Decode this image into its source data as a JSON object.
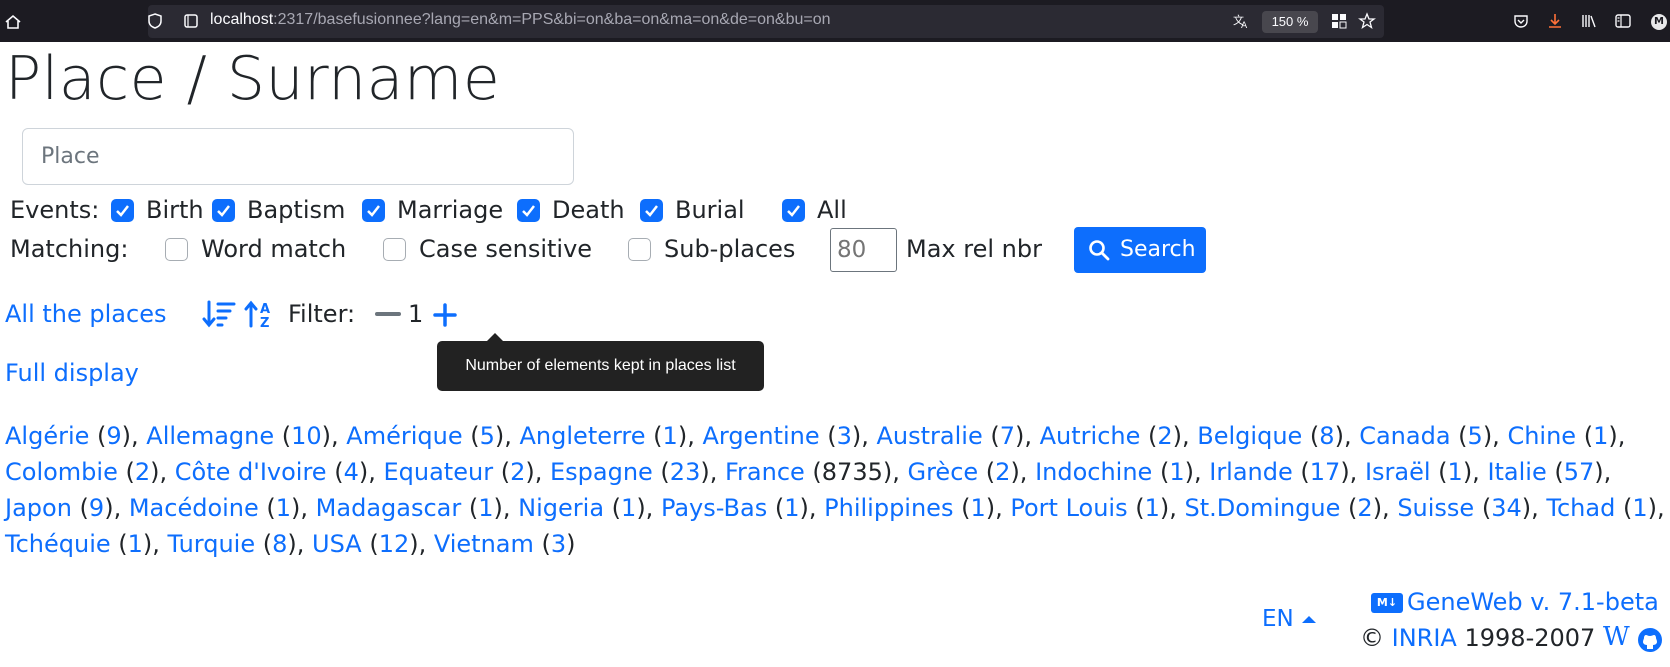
{
  "browser": {
    "url_host": "localhost",
    "url_rest": ":2317/basefusionnee?lang=en&m=PPS&bi=on&ba=on&ma=on&de=on&bu=on",
    "zoom": "150 %",
    "avatar_letter": "M"
  },
  "page": {
    "title": "Place / Surname",
    "place_placeholder": "Place",
    "events_label": "Events:",
    "events": [
      {
        "label": "Birth",
        "checked": true
      },
      {
        "label": "Baptism",
        "checked": true
      },
      {
        "label": "Marriage",
        "checked": true
      },
      {
        "label": "Death",
        "checked": true
      },
      {
        "label": "Burial",
        "checked": true
      },
      {
        "label": "All",
        "checked": true
      }
    ],
    "matching_label": "Matching:",
    "matching": [
      {
        "label": "Word match",
        "checked": false
      },
      {
        "label": "Case sensitive",
        "checked": false
      },
      {
        "label": "Sub-places",
        "checked": false
      }
    ],
    "max_rel_placeholder": "80",
    "max_rel_label": "Max rel nbr",
    "search_label": "Search",
    "all_places_label": "All the places",
    "filter_label": "Filter:",
    "filter_value": "1",
    "tooltip": "Number of elements kept in places list",
    "full_display_label": "Full display",
    "places": [
      {
        "name": "Algérie",
        "count": "9"
      },
      {
        "name": "Allemagne",
        "count": "10"
      },
      {
        "name": "Amérique",
        "count": "5"
      },
      {
        "name": "Angleterre",
        "count": "1"
      },
      {
        "name": "Argentine",
        "count": "3"
      },
      {
        "name": "Australie",
        "count": "7"
      },
      {
        "name": "Autriche",
        "count": "2"
      },
      {
        "name": "Belgique",
        "count": "8"
      },
      {
        "name": "Canada",
        "count": "5"
      },
      {
        "name": "Chine",
        "count": "1"
      },
      {
        "name": "Colombie",
        "count": "2"
      },
      {
        "name": "Côte d'Ivoire",
        "count": "4"
      },
      {
        "name": "Equateur",
        "count": "2"
      },
      {
        "name": "Espagne",
        "count": "23"
      },
      {
        "name": "France",
        "count": "8735"
      },
      {
        "name": "Grèce",
        "count": "2"
      },
      {
        "name": "Indochine",
        "count": "1"
      },
      {
        "name": "Irlande",
        "count": "17"
      },
      {
        "name": "Israël",
        "count": "1"
      },
      {
        "name": "Italie",
        "count": "57"
      },
      {
        "name": "Japon",
        "count": "9"
      },
      {
        "name": "Macédoine",
        "count": "1"
      },
      {
        "name": "Madagascar",
        "count": "1"
      },
      {
        "name": "Nigeria",
        "count": "1"
      },
      {
        "name": "Pays-Bas",
        "count": "1"
      },
      {
        "name": "Philippines",
        "count": "1"
      },
      {
        "name": "Port Louis",
        "count": "1"
      },
      {
        "name": "St.Domingue",
        "count": "2"
      },
      {
        "name": "Suisse",
        "count": "34"
      },
      {
        "name": "Tchad",
        "count": "1"
      },
      {
        "name": "Tchéquie",
        "count": "1"
      },
      {
        "name": "Turquie",
        "count": "8"
      },
      {
        "name": "USA",
        "count": "12"
      },
      {
        "name": "Vietnam",
        "count": "3"
      }
    ]
  },
  "footer": {
    "lang": "EN",
    "md_badge": "M↓",
    "geneweb": "GeneWeb v. 7.1-beta",
    "copyright_symbol": "©",
    "inria": "INRIA",
    "years": "1998-2007",
    "wiki_glyph": "W"
  },
  "colors": {
    "link": "#0d6efd",
    "chrome_bg": "#1c1b22",
    "tooltip_bg": "#222222"
  },
  "icons": [
    "home-icon",
    "shield-icon",
    "lock-icon",
    "translate-icon",
    "extensions-icon",
    "bookmark-star-icon",
    "pocket-icon",
    "download-icon",
    "library-icon",
    "sidebar-icon",
    "search-icon",
    "sort-desc-icon",
    "sort-asc-icon",
    "minus-icon",
    "plus-icon",
    "markdown-icon",
    "wiki-icon",
    "github-icon"
  ]
}
